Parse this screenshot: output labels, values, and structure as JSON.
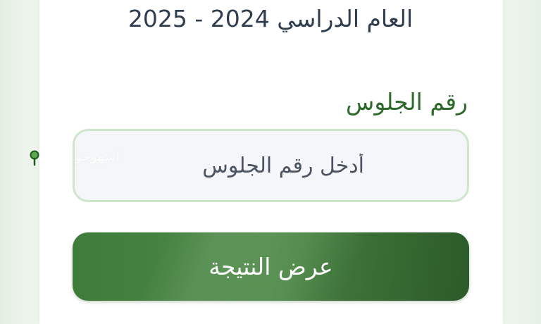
{
  "form": {
    "academic_year": "العام الدراسي 2024 - 2025",
    "seat_number_label": "رقم الجلوس",
    "seat_number_placeholder": "أدخل رقم الجلوس",
    "seat_number_value": "",
    "submit_label": "عرض النتيجة"
  },
  "watermark": {
    "text": "أشهوجو",
    "icon": "map-pin-icon"
  },
  "colors": {
    "primary_green": "#3f7c39",
    "label_green": "#2d6a2a",
    "input_border": "#cfe5cc",
    "title_text": "#2f3d4f"
  }
}
